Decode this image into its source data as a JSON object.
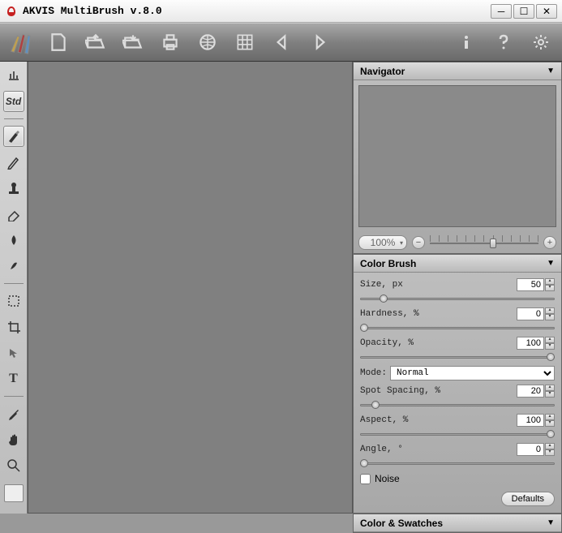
{
  "window": {
    "title": "AKVIS MultiBrush v.8.0"
  },
  "toolbar_top": {
    "icons": [
      "brushes",
      "new",
      "open",
      "save",
      "print",
      "web",
      "grid",
      "prev",
      "next",
      "info",
      "help",
      "settings"
    ]
  },
  "left_tools": {
    "std_label": "Std"
  },
  "navigator": {
    "title": "Navigator",
    "zoom_value": "100%"
  },
  "color_brush": {
    "title": "Color Brush",
    "size_label": "Size, px",
    "size_value": "50",
    "hardness_label": "Hardness, %",
    "hardness_value": "0",
    "opacity_label": "Opacity, %",
    "opacity_value": "100",
    "mode_label": "Mode:",
    "mode_value": "Normal",
    "spot_label": "Spot Spacing, %",
    "spot_value": "20",
    "aspect_label": "Aspect, %",
    "aspect_value": "100",
    "angle_label": "Angle, °",
    "angle_value": "0",
    "noise_label": "Noise",
    "defaults_label": "Defaults"
  },
  "swatches": {
    "title": "Color & Swatches"
  }
}
